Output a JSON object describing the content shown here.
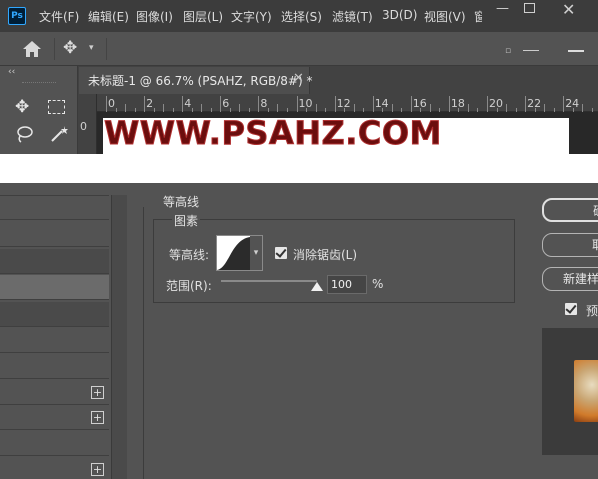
{
  "app": {
    "logo": "Ps"
  },
  "menu": [
    "文件(F)",
    "编辑(E)",
    "图像(I)",
    "图层(L)",
    "文字(Y)",
    "选择(S)",
    "滤镜(T)",
    "3D(D)",
    "视图(V)",
    "窗"
  ],
  "document": {
    "tab_title": "未标题-1 @ 66.7% (PSAHZ, RGB/8#) *",
    "canvas_text": "WWW.PSAHZ.COM"
  },
  "ruler": {
    "h": [
      "0",
      "2",
      "4",
      "6",
      "8",
      "10",
      "12",
      "14",
      "16",
      "18",
      "20",
      "22",
      "24"
    ],
    "v": [
      "0"
    ]
  },
  "dialog": {
    "section_title": "等高线",
    "group_title": "图素",
    "contour_label": "等高线:",
    "anti_alias_label": "消除锯齿(L)",
    "anti_alias_checked": true,
    "range_label": "范围(R):",
    "range_value": "100",
    "range_unit": "%",
    "buttons": [
      "确定",
      "取消",
      "新建样式..."
    ],
    "preview_label": "预",
    "preview_checked": true
  },
  "colors": {
    "canvas_text": "#6b0e0e",
    "panel_bg": "#535353",
    "menubar_bg": "#3c3c3c"
  }
}
